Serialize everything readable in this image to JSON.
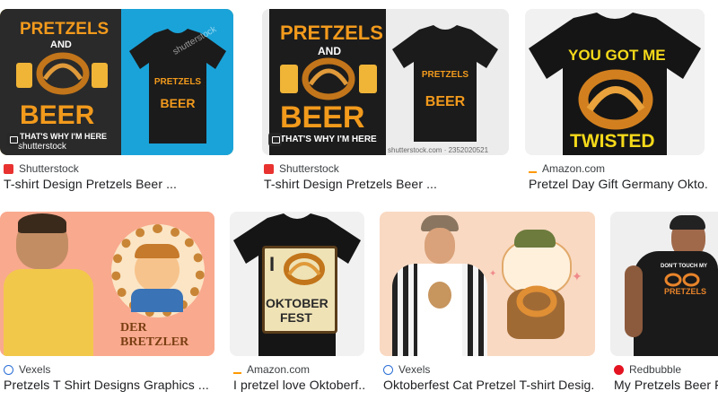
{
  "results": [
    {
      "source": "Shutterstock",
      "title": "T-shirt Design Pretzels Beer ...",
      "art": {
        "top": "PRETZELS",
        "mid": "AND",
        "big": "BEER",
        "sub": "THAT'S WHY I'M HERE"
      },
      "watermark": "shutterstock",
      "favicon": "shutterstock-icon",
      "color": "#e8322f"
    },
    {
      "source": "Shutterstock",
      "title": "T-shirt Design Pretzels Beer ...",
      "art": {
        "top": "PRETZELS",
        "mid": "AND",
        "big": "BEER",
        "sub": "THAT'S WHY I'M HERE"
      },
      "footer": "shutterstock.com · 2352020521",
      "favicon": "shutterstock-icon",
      "color": "#e8322f"
    },
    {
      "source": "Amazon.com",
      "title": "Pretzel Day Gift Germany Okto...",
      "art": {
        "top": "YOU GOT ME",
        "big": "TWISTED"
      },
      "favicon": "amazon-icon",
      "color": "#ff9900"
    },
    {
      "source": "Vexels",
      "title": "Pretzels T Shirt Designs Graphics ...",
      "art": {
        "big": "DER BRETZLER"
      },
      "favicon": "vexels-icon",
      "color": "#2b6fd6"
    },
    {
      "source": "Amazon.com",
      "title": "I pretzel love Oktoberf...",
      "art": {
        "top": "I",
        "big": "OKTOBER",
        "sub": "FEST"
      },
      "favicon": "amazon-icon",
      "color": "#ff9900"
    },
    {
      "source": "Vexels",
      "title": "Oktoberfest Cat Pretzel T-shirt Desig...",
      "favicon": "vexels-icon",
      "color": "#2b6fd6"
    },
    {
      "source": "Redbubble",
      "title": "My Pretzels Beer F...",
      "art": {
        "top": "DON'T TOUCH MY",
        "big": "PRETZELS"
      },
      "favicon": "redbubble-icon",
      "color": "#e41321"
    }
  ]
}
